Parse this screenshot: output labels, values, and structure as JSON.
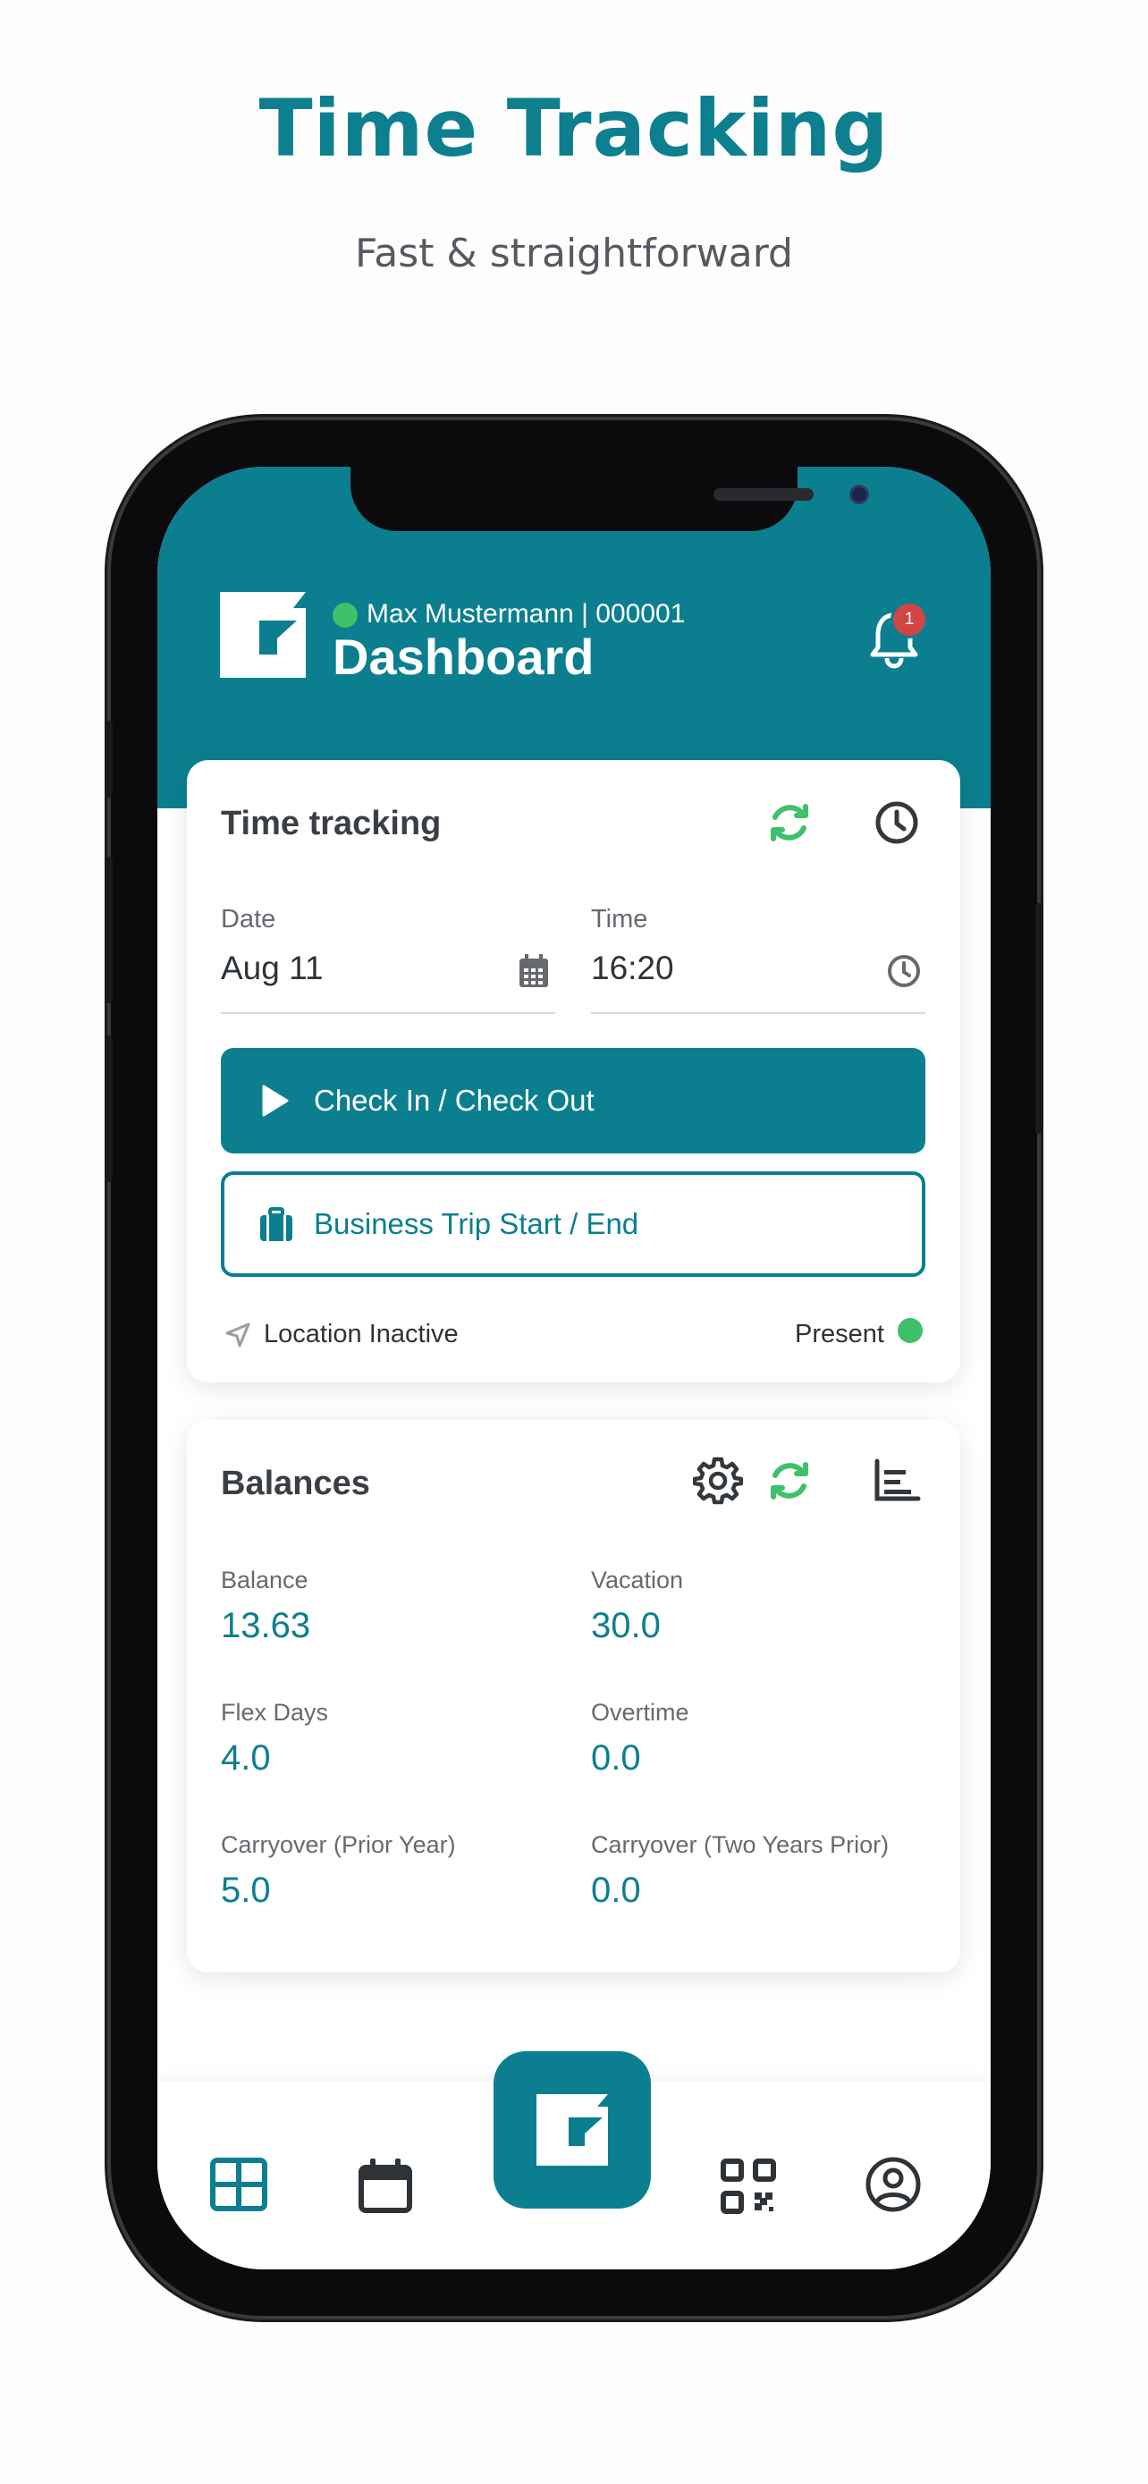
{
  "promo": {
    "headline": "Time Tracking",
    "subline": "Fast & straightforward"
  },
  "colors": {
    "accent": "#0b7f8f",
    "status_green": "#3fc06a",
    "badge_red": "#d14545",
    "refresh_green": "#3fc06a"
  },
  "header": {
    "user": "Max Mustermann | 000001",
    "title": "Dashboard",
    "notifications_count": "1",
    "user_status": "online"
  },
  "time_tracking": {
    "title": "Time tracking",
    "date_label": "Date",
    "date_value": "Aug 11",
    "time_label": "Time",
    "time_value": "16:20",
    "check_button": "Check In / Check Out",
    "trip_button": "Business Trip Start / End",
    "location_status": "Location Inactive",
    "presence_status": "Present"
  },
  "balances": {
    "title": "Balances",
    "items": [
      {
        "label": "Balance",
        "value": "13.63"
      },
      {
        "label": "Vacation",
        "value": "30.0"
      },
      {
        "label": "Flex Days",
        "value": "4.0"
      },
      {
        "label": "Overtime",
        "value": "0.0"
      },
      {
        "label": "Carryover (Prior Year)",
        "value": "5.0"
      },
      {
        "label": "Carryover (Two Years Prior)",
        "value": "0.0"
      }
    ]
  },
  "nav": {
    "items": [
      "dashboard-grid-icon",
      "calendar-icon",
      "app-logo-icon",
      "qr-code-icon",
      "profile-icon"
    ],
    "active": "dashboard-grid-icon"
  }
}
